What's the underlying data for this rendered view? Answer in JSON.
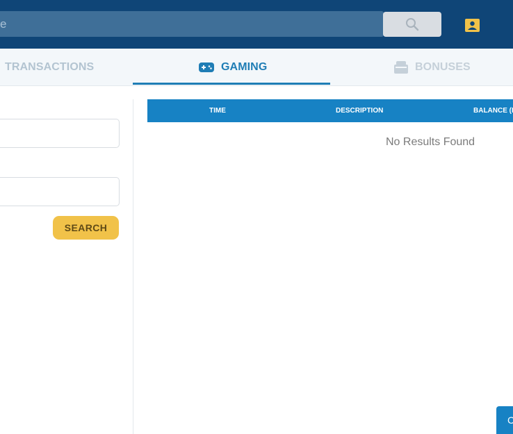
{
  "header": {
    "search_text": "e",
    "search_button_icon": "search-icon",
    "profile_icon": "profile-icon"
  },
  "tabs": [
    {
      "label": "TRANSACTIONS",
      "icon": "",
      "active": false
    },
    {
      "label": "GAMING",
      "icon": "gamepad-icon",
      "active": true
    },
    {
      "label": "BONUSES",
      "icon": "gift-icon",
      "active": false
    }
  ],
  "filters": {
    "search_label": "SEARCH"
  },
  "table": {
    "columns": [
      "TIME",
      "DESCRIPTION",
      "BALANCE (E"
    ],
    "empty_text": "No Results Found"
  },
  "chat": {
    "label": "C"
  },
  "colors": {
    "header_bg": "#0f4577",
    "accent": "#1782c4",
    "button_yellow": "#f1c249"
  }
}
